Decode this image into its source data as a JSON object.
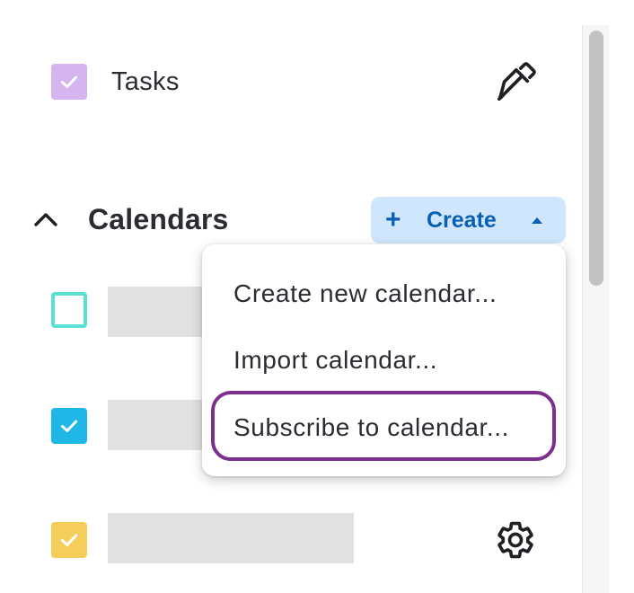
{
  "tasks": {
    "label": "Tasks",
    "checked": true,
    "color": "#d6b4ef"
  },
  "calendars": {
    "title": "Calendars",
    "create_button": {
      "plus": "+",
      "label": "Create"
    },
    "items": [
      {
        "checked": false,
        "color": "#5ce0d2"
      },
      {
        "checked": true,
        "color": "#1fb7e6"
      },
      {
        "checked": true,
        "color": "#f4cd5a"
      }
    ]
  },
  "menu": {
    "items": [
      {
        "label": "Create new calendar..."
      },
      {
        "label": "Import calendar..."
      },
      {
        "label": "Subscribe to calendar..."
      }
    ],
    "highlight_color": "#7b2f8e"
  },
  "colors": {
    "accent": "#0a5fb4",
    "accent_bg": "#cfe6fc",
    "placeholder": "#e1e1e1",
    "text": "#2b2b33"
  }
}
